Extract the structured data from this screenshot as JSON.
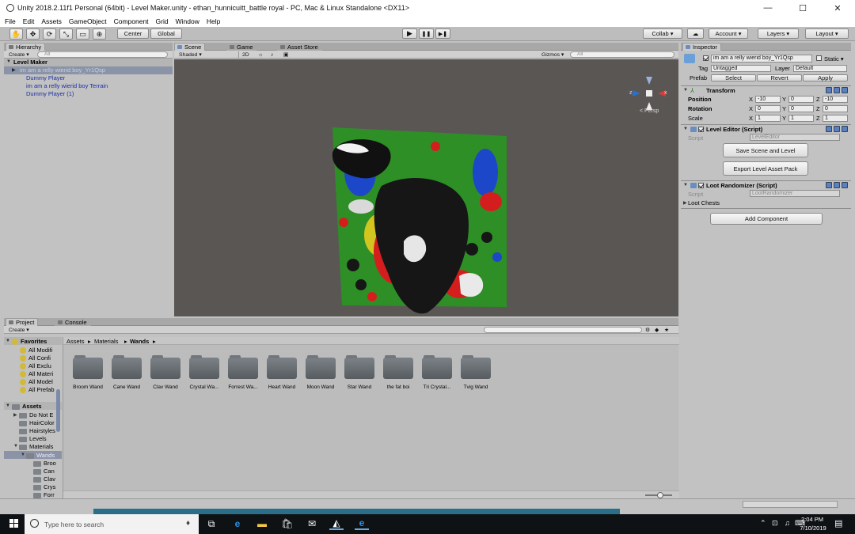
{
  "window": {
    "title": "Unity 2018.2.11f1 Personal (64bit) - Level Maker.unity - ethan_hunnicuitt_battle royal - PC, Mac & Linux Standalone <DX11>",
    "min": "—",
    "max": "☐",
    "close": "✕"
  },
  "menu": [
    "File",
    "Edit",
    "Assets",
    "GameObject",
    "Component",
    "Grid",
    "Window",
    "Help"
  ],
  "toolbar": {
    "tools": [
      "✋",
      "✥",
      "⟳",
      "⤡",
      "▭",
      "⊕"
    ],
    "pivot": "Center",
    "space": "Global",
    "play": "▶",
    "pause": "❚❚",
    "step": "▶❚",
    "collab": "Collab ▾",
    "cloud": "☁",
    "account": "Account ▾",
    "layers": "Layers ▾",
    "layout": "Layout ▾"
  },
  "hierarchy": {
    "tab": "Hierarchy",
    "create": "Create ▾",
    "search": "All",
    "scene": "Level Maker",
    "items": [
      "im am a relly wierid boy_Yr1Qsp",
      "Dummy Player",
      "im am a relly wierid boy Terrain",
      "Dummy Player (1)"
    ]
  },
  "scene": {
    "tab_scene": "Scene",
    "tab_game": "Game",
    "tab_store": "Asset Store",
    "shading": "Shaded ▾",
    "mode2d": "2D",
    "gizmos": "Gizmos ▾",
    "search": "All",
    "persp": "< Persp",
    "axis_z": "z",
    "axis_x": "x"
  },
  "inspector": {
    "tab": "Inspector",
    "object_name": "im am a relly wierid boy_Yr1Qsp",
    "static": "Static ▾",
    "tag_label": "Tag",
    "tag": "Untagged",
    "layer_label": "Layer",
    "layer": "Default",
    "prefab_label": "Prefab",
    "select": "Select",
    "revert": "Revert",
    "apply": "Apply",
    "transform": {
      "title": "Transform",
      "position": "Position",
      "rotation": "Rotation",
      "scale": "Scale",
      "x": "X",
      "y": "Y",
      "z": "Z",
      "pos": [
        "-10",
        "0",
        "-10"
      ],
      "rot": [
        "0",
        "0",
        "0"
      ],
      "scl": [
        "1",
        "1",
        "1"
      ]
    },
    "level_editor": {
      "title": "Level Editor (Script)",
      "script_label": "Script",
      "script": "LevelEditor",
      "save_btn": "Save Scene and Level",
      "export_btn": "Export Level Asset Pack"
    },
    "loot": {
      "title": "Loot Randomizer (Script)",
      "script_label": "Script",
      "script": "LootRandomizer",
      "chests": "Loot Chests"
    },
    "add_component": "Add Component"
  },
  "project": {
    "tab_project": "Project",
    "tab_console": "Console",
    "create": "Create ▾",
    "favorites": "Favorites",
    "fav_items": [
      "All Modifi",
      "All Confi",
      "All Exclu",
      "All Materi",
      "All Model",
      "All Prefab"
    ],
    "assets": "Assets",
    "asset_items": [
      "Do Not E",
      "HairColor",
      "Hairstyles",
      "Levels",
      "Materials",
      "Wands",
      "Broo",
      "Can",
      "Clav",
      "Crys",
      "Forr"
    ],
    "breadcrumb": [
      "Assets",
      "Materials",
      "Wands"
    ],
    "folders": [
      "Broom Wand",
      "Cane Wand",
      "Clav Wand",
      "Crystal Wa...",
      "Forrest Wa...",
      "Heart Wand",
      "Moon Wand",
      "Star Wand",
      "the fat boi",
      "Tri Crystal...",
      "Tvig Wand"
    ]
  },
  "taskbar": {
    "search": "Type here to search",
    "time": "2:04 PM",
    "date": "7/10/2019"
  }
}
